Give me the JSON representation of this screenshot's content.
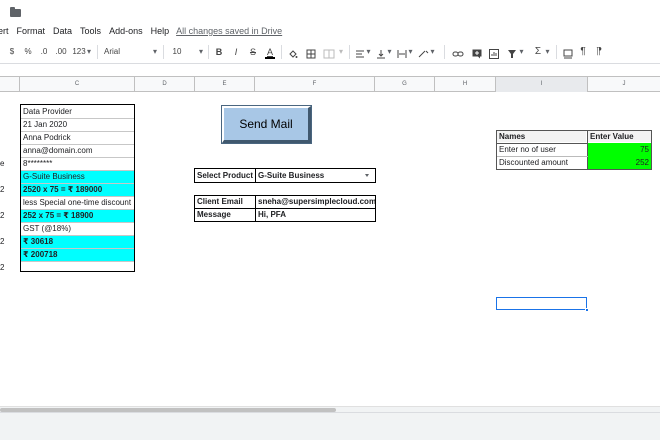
{
  "menu": {
    "items": [
      "ert",
      "Format",
      "Data",
      "Tools",
      "Add-ons",
      "Help"
    ],
    "saved_status": "All changes saved in Drive"
  },
  "toolbar": {
    "currency": "$",
    "percent": "%",
    "decimal_less": ".0",
    "decimal_more": ".00",
    "number_format": "123",
    "font": "Arial",
    "font_size": "10",
    "bold": "B",
    "italic": "I",
    "strike": "S",
    "text_color": "A",
    "sum": "Σ"
  },
  "columns": [
    "C",
    "D",
    "E",
    "F",
    "G",
    "H",
    "I",
    "J"
  ],
  "colC": [
    {
      "label": "",
      "text": "Data Provider",
      "style": ""
    },
    {
      "label": "",
      "text": "21 Jan 2020",
      "style": ""
    },
    {
      "label": "",
      "text": "Anna Podrick",
      "style": ""
    },
    {
      "label": "",
      "text": "anna@domain.com",
      "style": ""
    },
    {
      "label": "e",
      "text": "8********",
      "style": ""
    },
    {
      "label": "",
      "text": "G-Suite Business",
      "style": "cyan"
    },
    {
      "label": "2",
      "text": "2520 x 75 = ₹ 189000",
      "style": "cyan bold"
    },
    {
      "label": "",
      "text": "less Special one-time discount",
      "style": ""
    },
    {
      "label": "2",
      "text": "252 x 75 = ₹ 18900",
      "style": "cyan bold"
    },
    {
      "label": "",
      "text": "GST (@18%)",
      "style": ""
    },
    {
      "label": "2",
      "text": "₹ 30618",
      "style": "cyan bold"
    },
    {
      "label": "",
      "text": "₹ 200718",
      "style": "cyan bold"
    },
    {
      "label": "2",
      "text": "",
      "style": ""
    }
  ],
  "send_mail": {
    "label": "Send Mail"
  },
  "product": {
    "label": "Select Product",
    "value": "G-Suite Business"
  },
  "email_form": {
    "client_email_label": "Client Email",
    "client_email_value": "sneha@supersimplecloud.com",
    "message_label": "Message",
    "message_value": "Hi, PFA"
  },
  "pricing_table": {
    "header_names": "Names",
    "header_value": "Enter Value",
    "rows": [
      {
        "name": "Enter no of user",
        "value": "75"
      },
      {
        "name": "Discounted amount",
        "value": "252"
      }
    ]
  },
  "colors": {
    "cyan": "#00ffff",
    "green": "#00ff00",
    "button": "#a8c7e6"
  }
}
